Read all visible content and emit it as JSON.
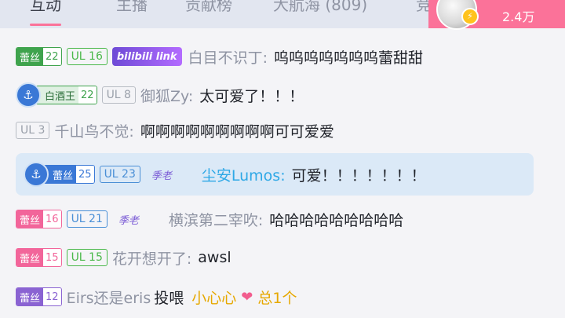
{
  "tabs": [
    {
      "label": "互动",
      "active": true
    },
    {
      "label": "主播",
      "active": false
    },
    {
      "label": "贡献榜",
      "active": false
    },
    {
      "label": "大航海 (809)",
      "active": false
    },
    {
      "label": "竞",
      "active": false
    }
  ],
  "header": {
    "online_count": "2.4万"
  },
  "messages": [
    {
      "fan_badge": {
        "name": "蕾丝",
        "level": "22",
        "color": "#3fa34d"
      },
      "ul": "UL 16",
      "ul_color": "#4ab84a",
      "medal": "bilibili link",
      "user": "白目不识丁:",
      "text": "呜呜呜呜呜呜呜蕾甜甜"
    },
    {
      "fan_badge": {
        "name": "白酒王",
        "level": "22",
        "color": "#3fa34d"
      },
      "ul": "UL 8",
      "ul_color": "#9aa0aa",
      "user": "御狐Zy:",
      "text": "太可爱了！！！"
    },
    {
      "ul": "UL 3",
      "ul_color": "#9aa0aa",
      "user": "千山鸟不觉:",
      "text": "啊啊啊啊啊啊啊啊啊可可爱爱"
    },
    {
      "fan_badge": {
        "name": "蕾丝",
        "level": "25",
        "color": "#3a78d6"
      },
      "ul": "UL 23",
      "ul_color": "#4a8fd6",
      "sticker": "季老",
      "user": "尘安Lumos:",
      "text": "可爱！！！！！！！"
    },
    {
      "fan_badge": {
        "name": "蕾丝",
        "level": "16",
        "color": "#f2659a"
      },
      "ul": "UL 21",
      "ul_color": "#4a8fd6",
      "sticker": "季老",
      "user": "横滨第二宰吹:",
      "text": "哈哈哈哈哈哈哈哈哈"
    },
    {
      "fan_badge": {
        "name": "蕾丝",
        "level": "15",
        "color": "#f2659a"
      },
      "ul": "UL 15",
      "ul_color": "#4ab84a",
      "user": "花开想开了:",
      "text": "awsl"
    },
    {
      "fan_badge": {
        "name": "蕾丝",
        "level": "12",
        "color": "#8a63d2"
      },
      "gift_user": "Eirs还是eris",
      "gift_action": "投喂",
      "gift_name": "小心心",
      "gift_total": "总1个"
    }
  ],
  "colors": {
    "accent": "#fb7299",
    "highlight_bg": "#dbe9f7"
  }
}
